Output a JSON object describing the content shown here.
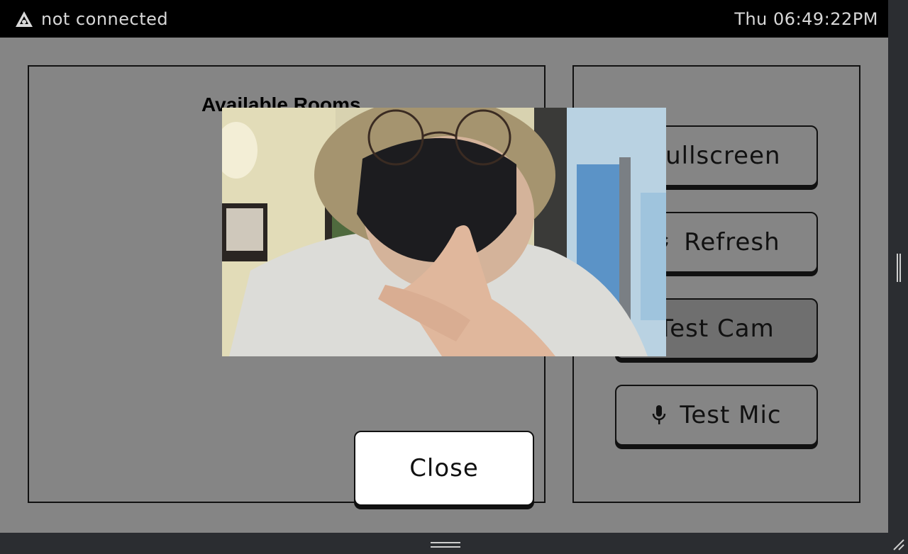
{
  "status_bar": {
    "connection_status": "not connected",
    "connection_icon": "network-icon",
    "clock": "Thu 06:49:22PM"
  },
  "rooms_panel": {
    "title": "Available Rooms"
  },
  "controls": {
    "fullscreen_label": "Fullscreen",
    "refresh_label": "Refresh",
    "test_cam_label": "Test Cam",
    "test_mic_label": "Test Mic",
    "refresh_icon": "refresh-icon",
    "mic_icon": "microphone-icon"
  },
  "camera_preview": {
    "label": "camera-preview"
  },
  "dialog": {
    "close_label": "Close"
  },
  "colors": {
    "background": "#858585",
    "status_bar": "#000000",
    "active_button": "#6f6f6f",
    "window_chrome": "#2b2d31"
  }
}
